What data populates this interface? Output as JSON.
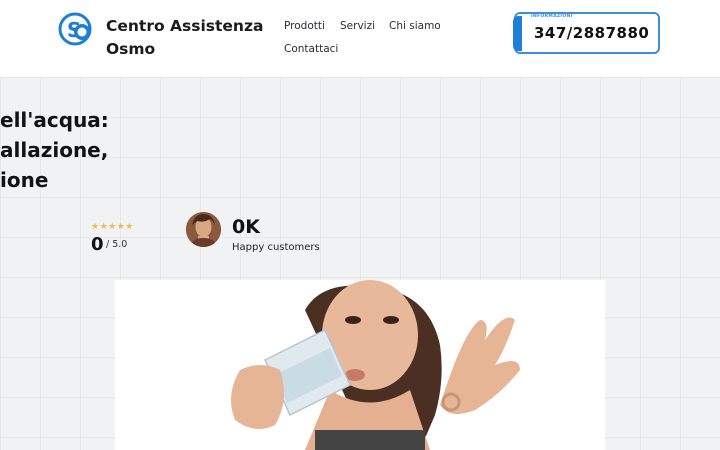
{
  "header": {
    "brand_line1": "Centro Assistenza",
    "brand_line2": "Osmo",
    "nav": {
      "prodotti": "Prodotti",
      "servizi": "Servizi",
      "chi_siamo": "Chi siamo",
      "contattaci": "Contattaci"
    },
    "phone": {
      "label": "INFORMAZIONI",
      "number": "347/2887880"
    }
  },
  "hero": {
    "line1": "ell'acqua:",
    "line2": "allazione,",
    "line3": "ione"
  },
  "stats": {
    "stars": "★★★★★",
    "rating_value": "0",
    "rating_scale": "/ 5.0",
    "customers_value": "0K",
    "customers_label": "Happy customers"
  },
  "colors": {
    "accent": "#1f7fd6",
    "star": "#f1b94a"
  }
}
